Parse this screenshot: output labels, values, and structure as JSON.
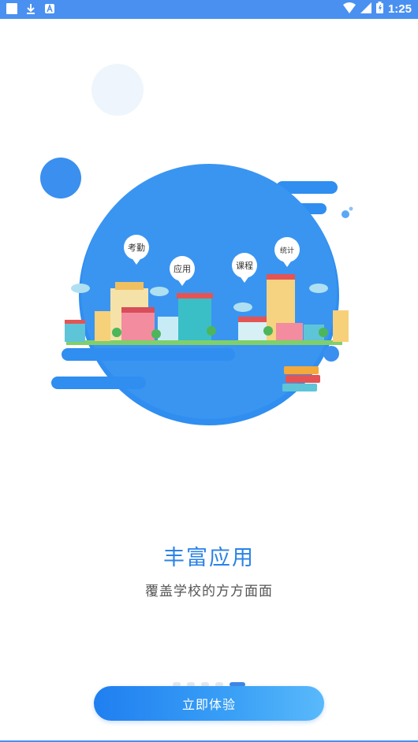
{
  "status_bar": {
    "time": "1:25",
    "icons": [
      "notification-square-icon",
      "download-icon",
      "a-icon",
      "wifi-icon",
      "signal-icon",
      "battery-icon"
    ]
  },
  "illustration": {
    "bubbles": [
      "考勤",
      "应用",
      "课程",
      "统计"
    ]
  },
  "main": {
    "title": "丰富应用",
    "subtitle": "覆盖学校的方方面面"
  },
  "pager": {
    "count": 5,
    "active_index": 4
  },
  "cta": {
    "label": "立即体验"
  },
  "colors": {
    "accent": "#2a83e6",
    "status_bar": "#4a90f0",
    "circle": "#2f8ef0"
  }
}
